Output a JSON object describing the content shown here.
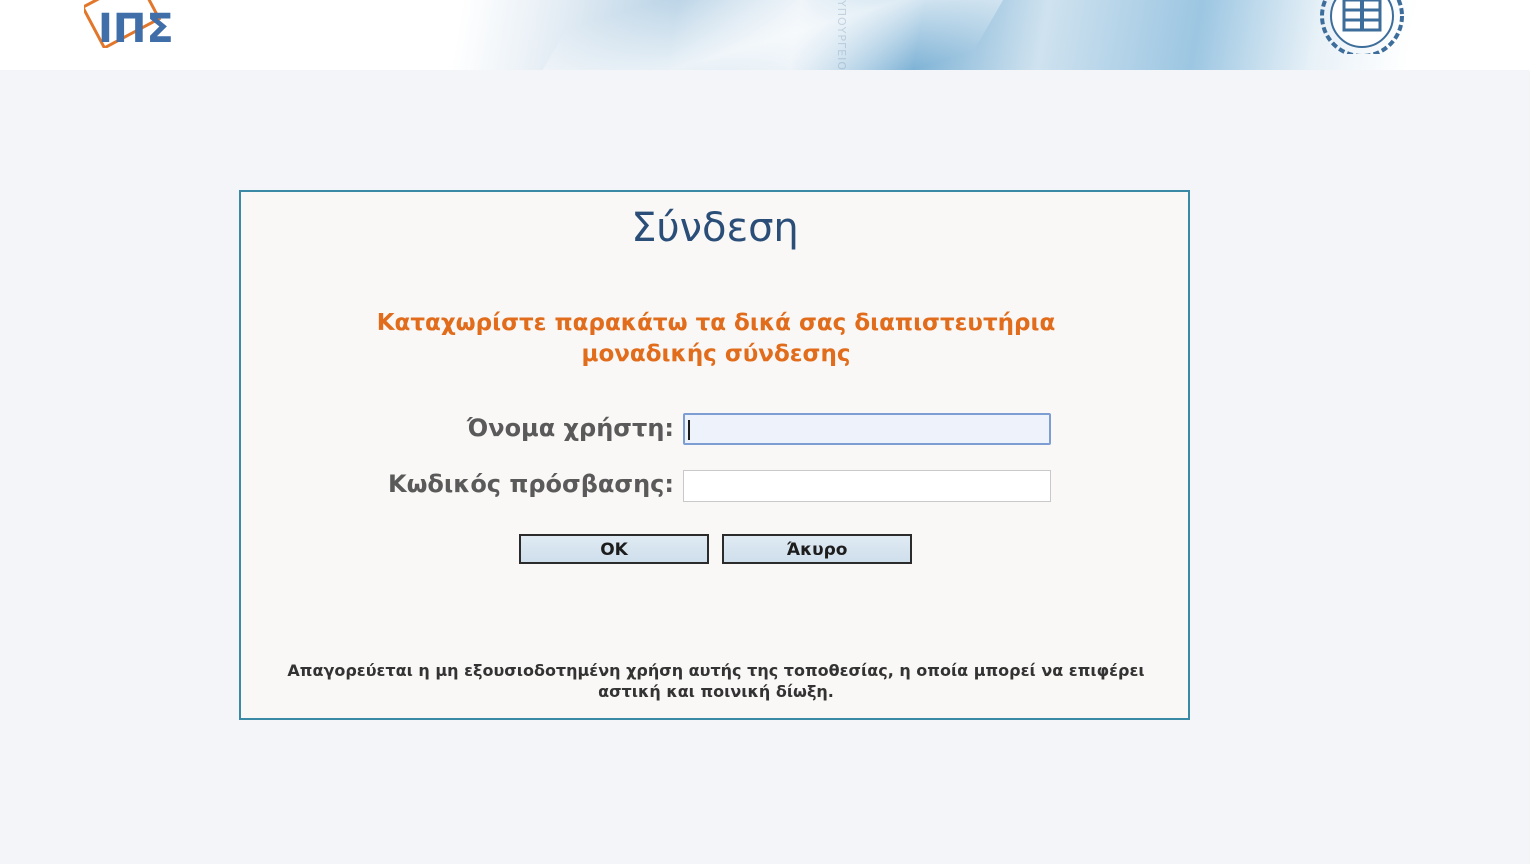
{
  "header": {
    "logo_text": "ΙΠΣ",
    "vertical_text": "ΥΠΟΥΡΓΕΙΟ"
  },
  "login": {
    "title": "Σύνδεση",
    "subtitle": "Καταχωρίστε παρακάτω τα δικά σας διαπιστευτήρια μοναδικής σύνδεσης",
    "username_label": "Όνομα χρήστη:",
    "username_value": "",
    "password_label": "Κωδικός πρόσβασης:",
    "password_value": "",
    "ok_label": "OK",
    "cancel_label": "Άκυρο",
    "disclaimer": "Απαγορεύεται η μη εξουσιοδοτημένη χρήση αυτής της τοποθεσίας, η οποία μπορεί να επιφέρει αστική και ποινική δίωξη."
  },
  "colors": {
    "accent_orange": "#e06c1c",
    "title_blue": "#2a4e78",
    "box_border": "#3a8aa6"
  },
  "icons": [
    "ips-logo-icon",
    "greek-emblem-icon"
  ]
}
